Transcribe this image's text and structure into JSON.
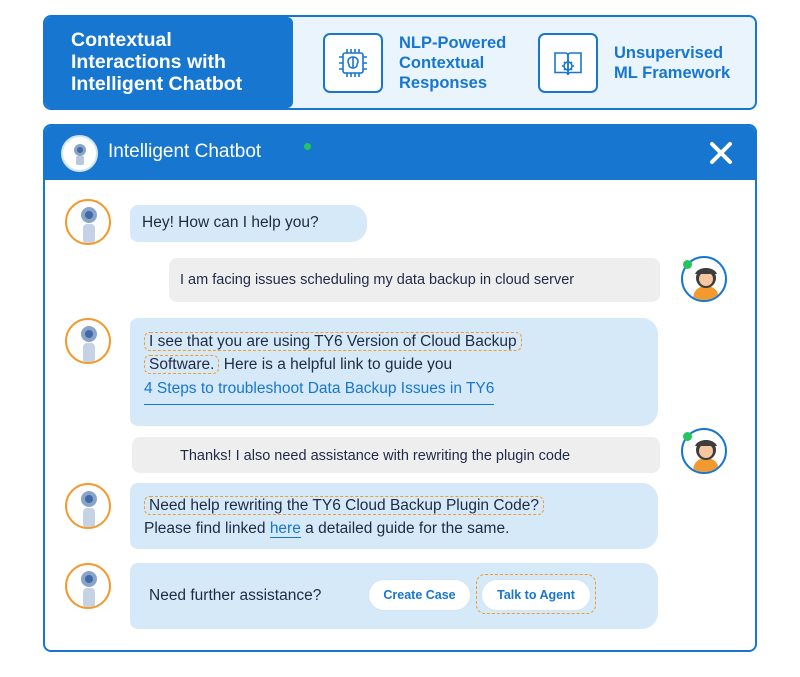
{
  "banner": {
    "title_lines": [
      "Contextual",
      "Interactions with",
      "Intelligent Chatbot"
    ],
    "features": [
      {
        "icon": "brain-chip-icon",
        "lines": [
          "NLP-Powered",
          "Contextual",
          "Responses"
        ]
      },
      {
        "icon": "gear-book-icon",
        "lines": [
          "Unsupervised",
          "ML Framework"
        ]
      }
    ]
  },
  "chat": {
    "header": {
      "title": "Intelligent Chatbot",
      "status": "online",
      "close_label": "X"
    },
    "messages": {
      "m1": "Hey! How can I help you?",
      "m2": "I am facing issues scheduling my data backup in cloud server",
      "m3": {
        "hl1": "I see that you are using TY6 Version of Cloud Backup",
        "hl2": "Software.",
        "rest": "Here is a helpful link to guide you",
        "link": "4 Steps to troubleshoot Data Backup Issues in TY6"
      },
      "m4": "Thanks! I also need assistance with rewriting the plugin code",
      "m5": {
        "hl": "Need help rewriting the TY6 Cloud Backup Plugin Code?",
        "pre": "Please find linked",
        "link": "here",
        "post": "a detailed guide for the same."
      },
      "m6": {
        "text": "Need further assistance?",
        "button1": "Create Case",
        "button2": "Talk to Agent"
      }
    }
  },
  "colors": {
    "primary": "#1776d0",
    "highlight": "#f29a2e",
    "bot_bubble": "#d6e9f8",
    "user_bubble": "#eeeeee",
    "online": "#22c55e"
  }
}
